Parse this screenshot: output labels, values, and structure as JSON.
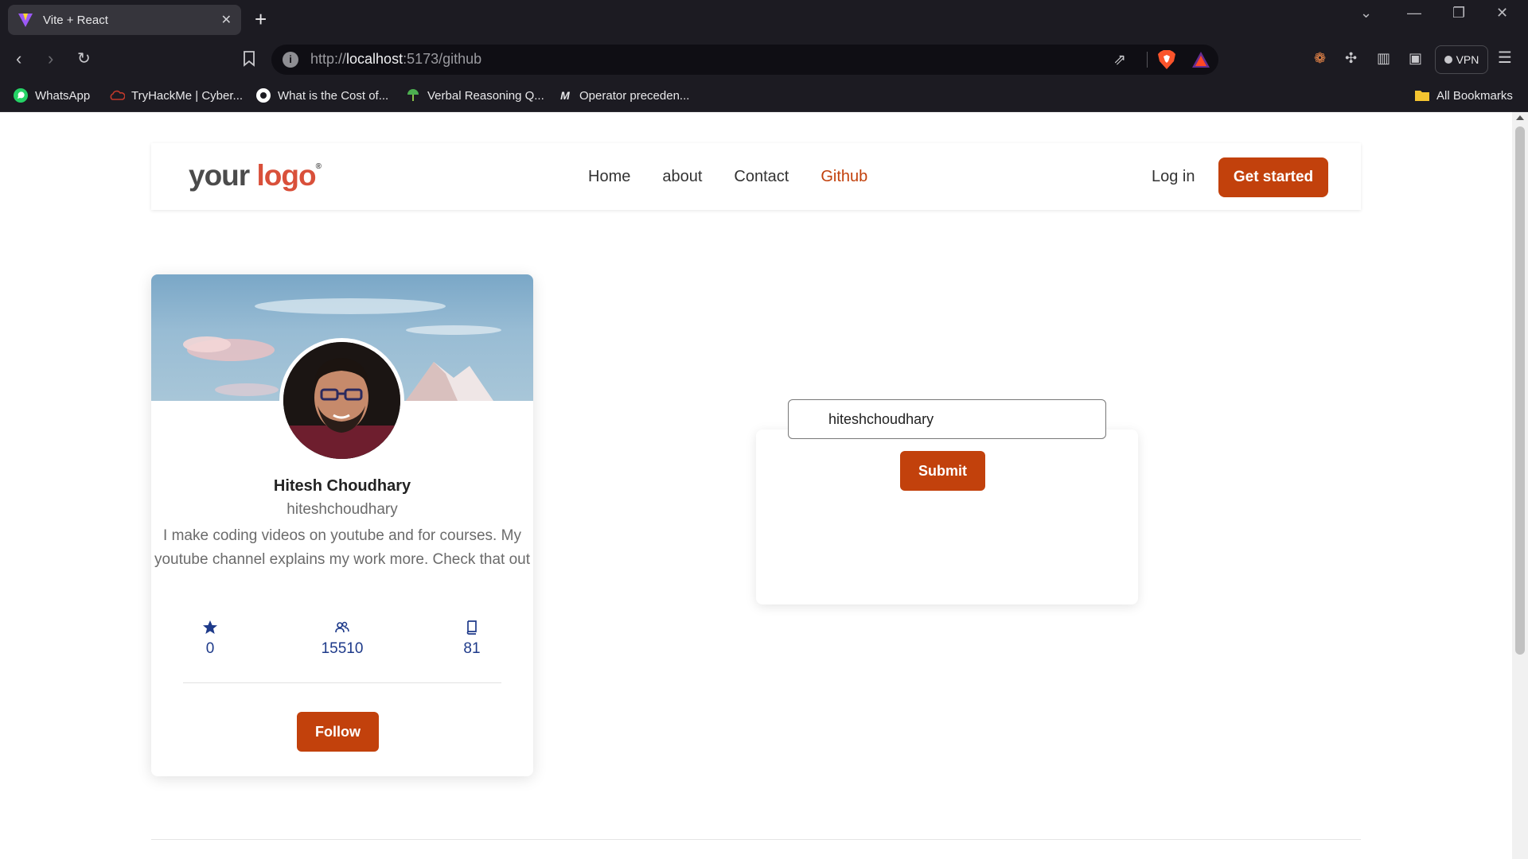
{
  "browser": {
    "tab_title": "Vite + React",
    "url_scheme": "http://",
    "url_host": "localhost",
    "url_path": ":5173/github",
    "vpn_label": "VPN",
    "bookmarks": [
      {
        "label": "WhatsApp",
        "icon": "whatsapp-icon"
      },
      {
        "label": "TryHackMe | Cyber...",
        "icon": "tryhackme-icon"
      },
      {
        "label": "What is the Cost of...",
        "icon": "site-icon"
      },
      {
        "label": "Verbal Reasoning Q...",
        "icon": "site-icon"
      },
      {
        "label": "Operator preceden...",
        "icon": "site-icon"
      }
    ],
    "all_bookmarks_label": "All Bookmarks"
  },
  "header": {
    "logo_your": "your",
    "logo_logo": "logo",
    "logo_mark": "®",
    "nav": [
      {
        "label": "Home",
        "active": false
      },
      {
        "label": "about",
        "active": false
      },
      {
        "label": "Contact",
        "active": false
      },
      {
        "label": "Github",
        "active": true
      }
    ],
    "login_label": "Log in",
    "cta_label": "Get started"
  },
  "profile": {
    "name": "Hitesh Choudhary",
    "login": "hiteshchoudhary",
    "bio": "I make coding videos on youtube and for courses. My youtube channel explains my work more. Check that out",
    "stats": [
      {
        "icon": "star-icon",
        "value": "0"
      },
      {
        "icon": "followers-icon",
        "value": "15510"
      },
      {
        "icon": "repo-icon",
        "value": "81"
      }
    ],
    "follow_label": "Follow"
  },
  "search": {
    "value": "hiteshchoudhary",
    "submit_label": "Submit"
  },
  "colors": {
    "accent": "#c2410c",
    "nav_active": "#c2410c",
    "stat_color": "#1e3a8a",
    "chrome_bg": "#1c1b22"
  }
}
